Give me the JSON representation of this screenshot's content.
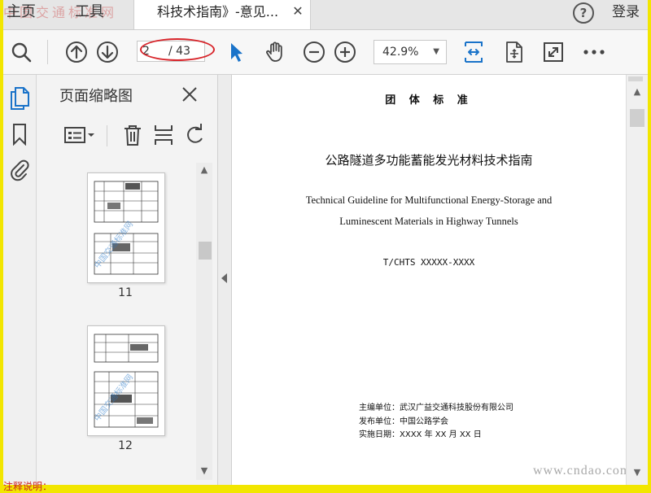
{
  "watermark_top": "中国交通标准网",
  "tabs": {
    "home": "主页",
    "tools": "工具",
    "document": "科技术指南》-意见..."
  },
  "header": {
    "login": "登录"
  },
  "toolbar": {
    "current_page": "2",
    "total_pages": "/ 43",
    "zoom": "42.9%"
  },
  "thumbnails_panel": {
    "title": "页面缩略图",
    "pages": [
      {
        "number": "11",
        "watermark": "中国交通标准网"
      },
      {
        "number": "12",
        "watermark": "中国交通标准网"
      }
    ]
  },
  "document": {
    "standard_type": "团 体 标 准",
    "title_cn": "公路隧道多功能蓄能发光材料技术指南",
    "title_en_line1": "Technical Guideline for Multifunctional Energy-Storage and",
    "title_en_line2": "Luminescent Materials in Highway Tunnels",
    "code": "T/CHTS XXXXX-XXXX",
    "meta": [
      {
        "label": "主编单位：",
        "value": "武汉广益交通科技股份有限公司"
      },
      {
        "label": "发布单位：",
        "value": "中国公路学会"
      },
      {
        "label": "实施日期：",
        "value": "XXXX 年 XX 月 XX 日"
      }
    ]
  },
  "watermark_site": "www.cndao.com",
  "bottom_text": "注释说明："
}
